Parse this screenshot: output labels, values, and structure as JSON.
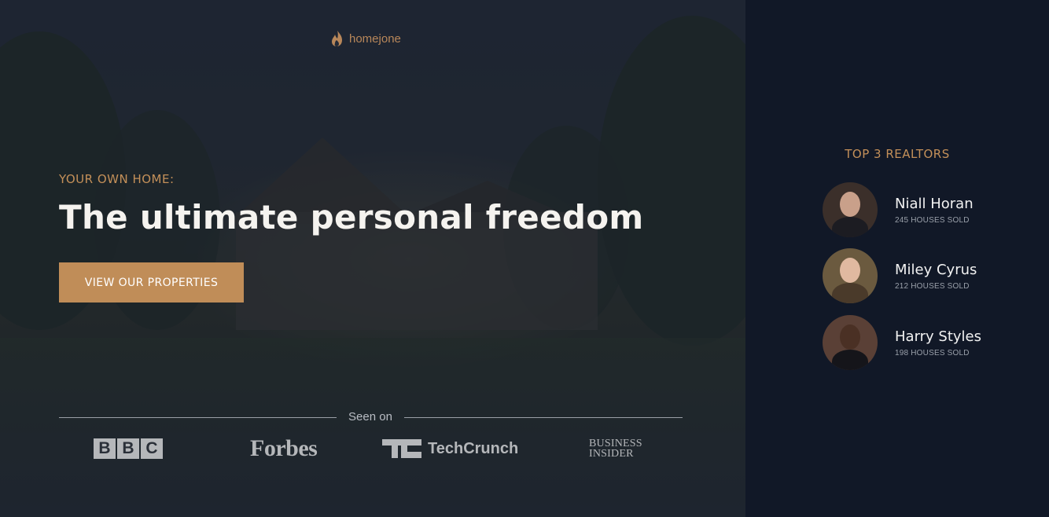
{
  "brand": {
    "logo_text": "homejone",
    "icon": "flame-icon",
    "accent_color": "#c08d58"
  },
  "hero": {
    "eyebrow": "YOUR OWN HOME:",
    "headline": "The ultimate personal freedom",
    "cta_label": "VIEW OUR PROPERTIES",
    "background_image": "house-at-dusk-photo"
  },
  "press": {
    "label": "Seen on",
    "logos": [
      {
        "name": "BBC",
        "letters": [
          "B",
          "B",
          "C"
        ]
      },
      {
        "name": "Forbes"
      },
      {
        "name": "TechCrunch"
      },
      {
        "name": "Business Insider",
        "line1": "BUSINESS",
        "line2": "INSIDER"
      }
    ]
  },
  "sidebar": {
    "title": "TOP 3 REALTORS",
    "realtors": [
      {
        "name": "Niall Horan",
        "sold": "245 HOUSES SOLD"
      },
      {
        "name": "Miley Cyrus",
        "sold": "212 HOUSES SOLD"
      },
      {
        "name": "Harry Styles",
        "sold": "198 HOUSES SOLD"
      }
    ]
  },
  "colors": {
    "sidebar_bg": "#111827",
    "gold": "#c49059",
    "text_light": "#f5f3ef"
  }
}
